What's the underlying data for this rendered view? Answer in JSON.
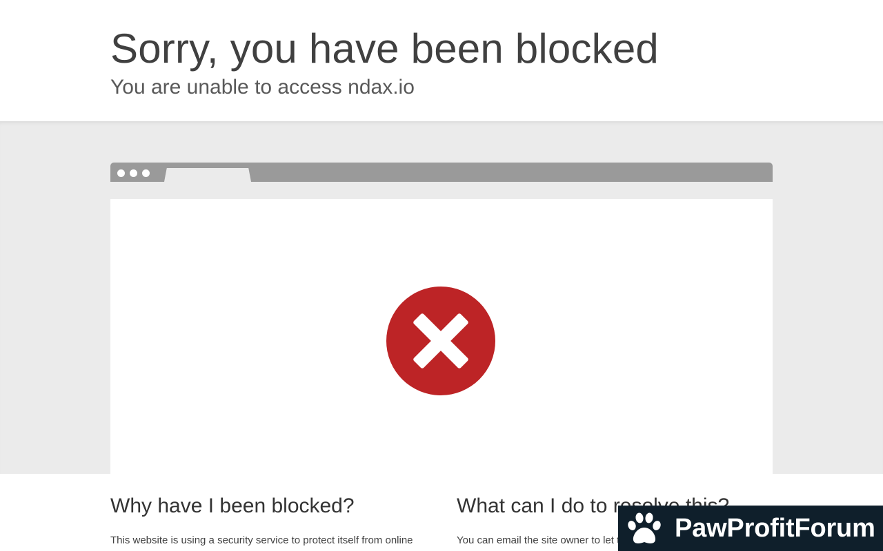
{
  "header": {
    "title": "Sorry, you have been blocked",
    "subtitle": "You are unable to access ndax.io"
  },
  "colors": {
    "accent_red": "#bd2426",
    "stage_gray": "#ebebeb",
    "browser_bar": "#9a9a9a",
    "watermark_bg": "#0f1f2b"
  },
  "icons": {
    "block": "close-x-circle-icon",
    "paw": "paw-icon"
  },
  "sections": {
    "why": {
      "heading": "Why have I been blocked?",
      "body": "This website is using a security service to protect itself from online"
    },
    "resolve": {
      "heading": "What can I do to resolve this?",
      "body": "You can email the site owner to let them know you were blocked."
    }
  },
  "watermark": {
    "label": "PawProfitForum"
  }
}
